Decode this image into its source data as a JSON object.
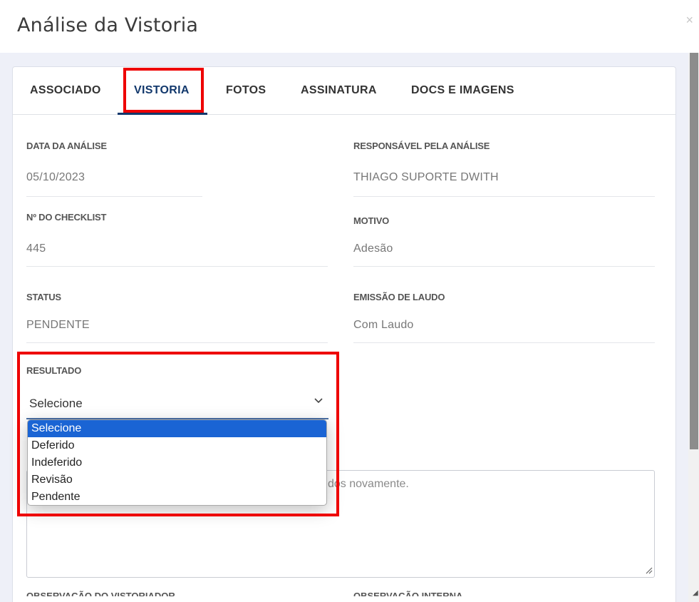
{
  "modal": {
    "title": "Análise da Vistoria",
    "close_glyph": "×"
  },
  "tabs": [
    {
      "label": "ASSOCIADO"
    },
    {
      "label": "VISTORIA"
    },
    {
      "label": "FOTOS"
    },
    {
      "label": "ASSINATURA"
    },
    {
      "label": "DOCS E IMAGENS"
    }
  ],
  "fields": {
    "data_analise": {
      "label": "DATA DA ANÁLISE",
      "value": "05/10/2023"
    },
    "responsavel": {
      "label": "RESPONSÁVEL PELA ANÁLISE",
      "value": "THIAGO SUPORTE DWITH"
    },
    "checklist": {
      "label": "Nº DO CHECKLIST",
      "value": "445"
    },
    "motivo": {
      "label": "MOTIVO",
      "value": "Adesão"
    },
    "status": {
      "label": "STATUS",
      "value": "PENDENTE"
    },
    "laudo": {
      "label": "EMISSÃO DE LAUDO",
      "value": "Com Laudo"
    },
    "resultado": {
      "label": "RESULTADO",
      "value": "Selecione"
    }
  },
  "resultado_options": [
    "Selecione",
    "Deferido",
    "Indeferido",
    "Revisão",
    "Pendente"
  ],
  "textarea": {
    "visible_text": "dos novamente."
  },
  "cut_labels": {
    "left": "OBSERVAÇÃO DO VISTORIADOR",
    "right": "OBSERVAÇÃO INTERNA"
  },
  "colors": {
    "accent": "#12386c",
    "highlight": "#ee0000",
    "selected_option": "#1a64d4"
  }
}
